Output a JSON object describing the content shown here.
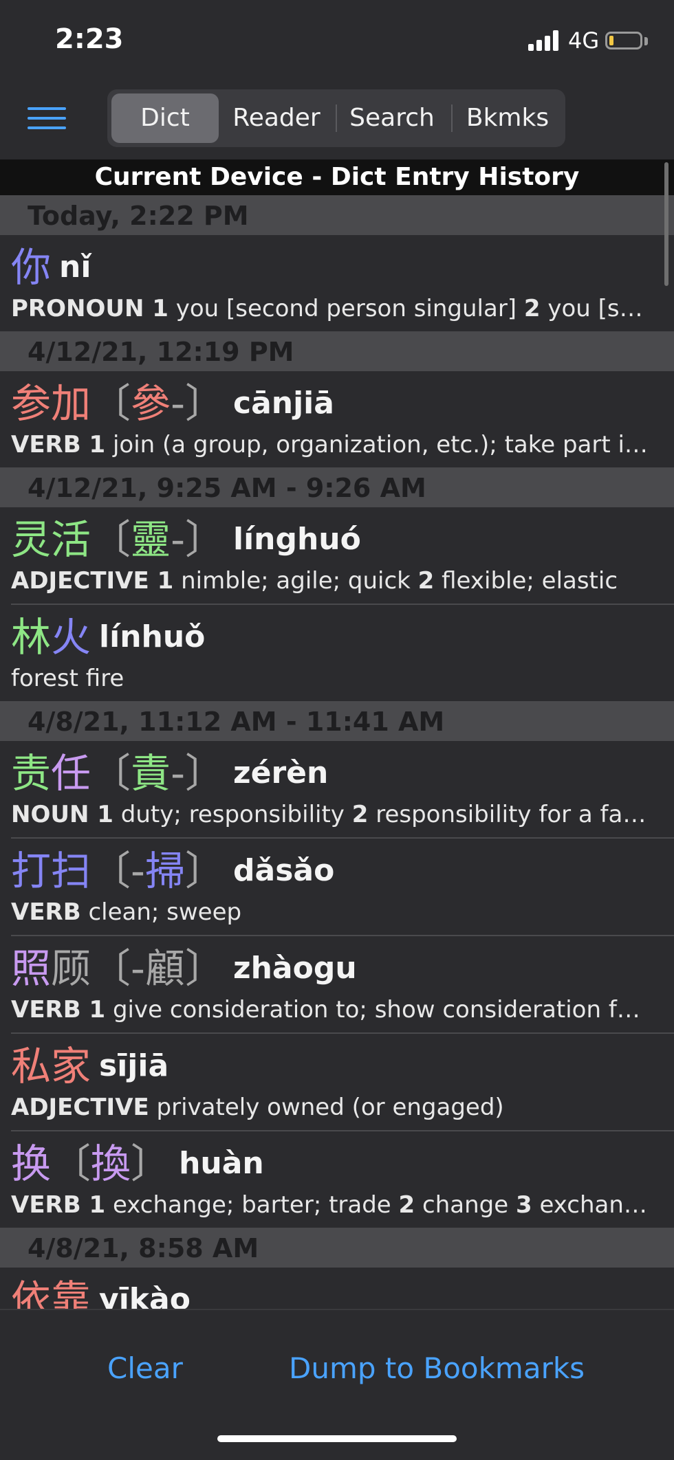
{
  "status": {
    "time": "2:23",
    "network": "4G"
  },
  "nav": {
    "tabs": [
      "Dict",
      "Reader",
      "Search",
      "Bkmks"
    ],
    "active": 0
  },
  "list_title": "Current Device - Dict Entry History",
  "sections": [
    {
      "label": "Today, 2:22 PM",
      "entries": [
        {
          "hz": [
            [
              "你",
              "c-blue"
            ]
          ],
          "trad": [],
          "pinyin": "nǐ",
          "def": [
            [
              "b",
              "PRONOUN "
            ],
            [
              "b",
              "1"
            ],
            [
              "t",
              " you [second person singular]  "
            ],
            [
              "b",
              "2"
            ],
            [
              "t",
              " you [s…"
            ]
          ]
        }
      ]
    },
    {
      "label": "4/12/21, 12:19 PM",
      "entries": [
        {
          "hz": [
            [
              "参",
              "c-red"
            ],
            [
              "加",
              "c-red"
            ]
          ],
          "trad": [
            [
              "〔",
              "c-gray"
            ],
            [
              "參",
              "c-red"
            ],
            [
              "-〕",
              "c-gray"
            ]
          ],
          "pinyin": "cānjiā",
          "def": [
            [
              "b",
              "VERB "
            ],
            [
              "b",
              "1"
            ],
            [
              "t",
              " join (a group, organization, etc.); take part i…"
            ]
          ]
        }
      ]
    },
    {
      "label": "4/12/21, 9:25 AM - 9:26 AM",
      "entries": [
        {
          "hz": [
            [
              "灵",
              "c-green"
            ],
            [
              "活",
              "c-green"
            ]
          ],
          "trad": [
            [
              "〔",
              "c-gray"
            ],
            [
              "靈",
              "c-green"
            ],
            [
              "-〕",
              "c-gray"
            ]
          ],
          "pinyin": "línghuó",
          "def": [
            [
              "b",
              "ADJECTIVE "
            ],
            [
              "b",
              "1"
            ],
            [
              "t",
              " nimble; agile; quick  "
            ],
            [
              "b",
              "2"
            ],
            [
              "t",
              " flexible; elastic"
            ]
          ]
        },
        {
          "hz": [
            [
              "林",
              "c-green"
            ],
            [
              "火",
              "c-blue"
            ]
          ],
          "trad": [],
          "pinyin": "línhuǒ",
          "def": [
            [
              "t",
              "forest fire"
            ]
          ]
        }
      ]
    },
    {
      "label": "4/8/21, 11:12 AM - 11:41 AM",
      "entries": [
        {
          "hz": [
            [
              "责",
              "c-green"
            ],
            [
              "任",
              "c-purple"
            ]
          ],
          "trad": [
            [
              "〔",
              "c-gray"
            ],
            [
              "責",
              "c-green"
            ],
            [
              "-〕",
              "c-gray"
            ]
          ],
          "pinyin": "zérèn",
          "def": [
            [
              "b",
              "NOUN "
            ],
            [
              "b",
              "1"
            ],
            [
              "t",
              " duty; responsibility  "
            ],
            [
              "b",
              "2"
            ],
            [
              "t",
              " responsibility for a fa…"
            ]
          ]
        },
        {
          "hz": [
            [
              "打",
              "c-blue"
            ],
            [
              "扫",
              "c-blue"
            ]
          ],
          "trad": [
            [
              "〔-",
              "c-gray"
            ],
            [
              "掃",
              "c-blue"
            ],
            [
              "〕",
              "c-gray"
            ]
          ],
          "pinyin": "dǎsǎo",
          "def": [
            [
              "b",
              "VERB"
            ],
            [
              "t",
              " clean; sweep"
            ]
          ]
        },
        {
          "hz": [
            [
              "照",
              "c-purple"
            ],
            [
              "顾",
              "c-gray"
            ]
          ],
          "trad": [
            [
              "〔-",
              "c-gray"
            ],
            [
              "顧",
              "c-gray"
            ],
            [
              "〕",
              "c-gray"
            ]
          ],
          "pinyin": "zhàogu",
          "def": [
            [
              "b",
              "VERB "
            ],
            [
              "b",
              "1"
            ],
            [
              "t",
              " give consideration to; show consideration f…"
            ]
          ]
        },
        {
          "hz": [
            [
              "私",
              "c-red"
            ],
            [
              "家",
              "c-red"
            ]
          ],
          "trad": [],
          "pinyin": "sījiā",
          "def": [
            [
              "b",
              "ADJECTIVE"
            ],
            [
              "t",
              " privately owned (or engaged)"
            ]
          ]
        },
        {
          "hz": [
            [
              "换",
              "c-purple"
            ]
          ],
          "trad": [
            [
              "〔",
              "c-gray"
            ],
            [
              "換",
              "c-purple"
            ],
            [
              "〕",
              "c-gray"
            ]
          ],
          "pinyin": "huàn",
          "def": [
            [
              "b",
              "VERB "
            ],
            [
              "b",
              "1"
            ],
            [
              "t",
              " exchange; barter; trade  "
            ],
            [
              "b",
              "2"
            ],
            [
              "t",
              " change  "
            ],
            [
              "b",
              "3"
            ],
            [
              "t",
              " exchan…"
            ]
          ]
        }
      ]
    },
    {
      "label": "4/8/21, 8:58 AM",
      "entries": [
        {
          "hz": [
            [
              "依",
              "c-red"
            ],
            [
              "靠",
              "c-red"
            ]
          ],
          "trad": [],
          "pinyin": "yīkào",
          "def": [
            [
              "t",
              ""
            ]
          ]
        }
      ]
    }
  ],
  "bottom": {
    "clear": "Clear",
    "dump": "Dump to Bookmarks"
  }
}
